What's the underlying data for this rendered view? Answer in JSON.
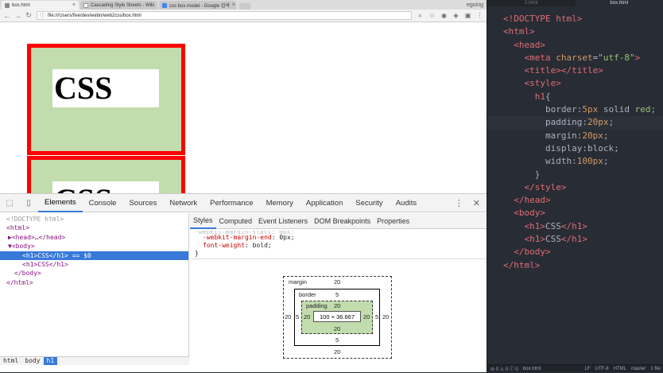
{
  "browser": {
    "tabs": [
      {
        "label": "box.html",
        "active": true
      },
      {
        "label": "Cascading Style Sheets - Wiki",
        "active": false
      },
      {
        "label": "css box model - Google 검색",
        "active": false
      }
    ],
    "account": "egoing",
    "url": "file:///Users/five/dev/webn/web2css/box.html"
  },
  "page": {
    "h1_text_1": "CSS",
    "h1_text_2": "CSS"
  },
  "devtools": {
    "tabs": [
      "Elements",
      "Console",
      "Sources",
      "Network",
      "Performance",
      "Memory",
      "Application",
      "Security",
      "Audits"
    ],
    "active_tab": "Elements",
    "dom_lines": [
      {
        "text": "<!DOCTYPE html>",
        "selected": false,
        "indent": 0
      },
      {
        "text": "<html>",
        "selected": false,
        "indent": 0
      },
      {
        "text": "▶<head>…</head>",
        "selected": false,
        "indent": 1
      },
      {
        "text": "▼<body>",
        "selected": false,
        "indent": 1
      },
      {
        "text": "<h1>CSS</h1> == $0",
        "selected": true,
        "indent": 2
      },
      {
        "text": "<h1>CSS</h1>",
        "selected": false,
        "indent": 2
      },
      {
        "text": "</body>",
        "selected": false,
        "indent": 1
      },
      {
        "text": "</html>",
        "selected": false,
        "indent": 0
      }
    ],
    "breadcrumbs": [
      "html",
      "body",
      "h1"
    ],
    "subtabs": [
      "Styles",
      "Computed",
      "Event Listeners",
      "DOM Breakpoints",
      "Properties"
    ],
    "css_lines": {
      "faded": "-webkit-margin-start: 0px;",
      "line1_prop": "-webkit-margin-end",
      "line1_val": "0px;",
      "line2_prop": "font-weight",
      "line2_val": "bold;",
      "close": "}"
    },
    "boxmodel": {
      "margin_label": "margin",
      "border_label": "border",
      "padding_label": "padding",
      "margin": "20",
      "border": "5",
      "padding": "20",
      "content": "100 × 36.667"
    }
  },
  "editor": {
    "tabs": [
      "2.html",
      "box.html"
    ],
    "active_tab": "box.html",
    "status": {
      "left": "⊘ 0  ⚠ 0  ⓘ 0",
      "file": "box.html",
      "encoding": "UTF-8",
      "ending": "LF",
      "grammar": "HTML",
      "branch": "master",
      "files": "1 file"
    }
  }
}
